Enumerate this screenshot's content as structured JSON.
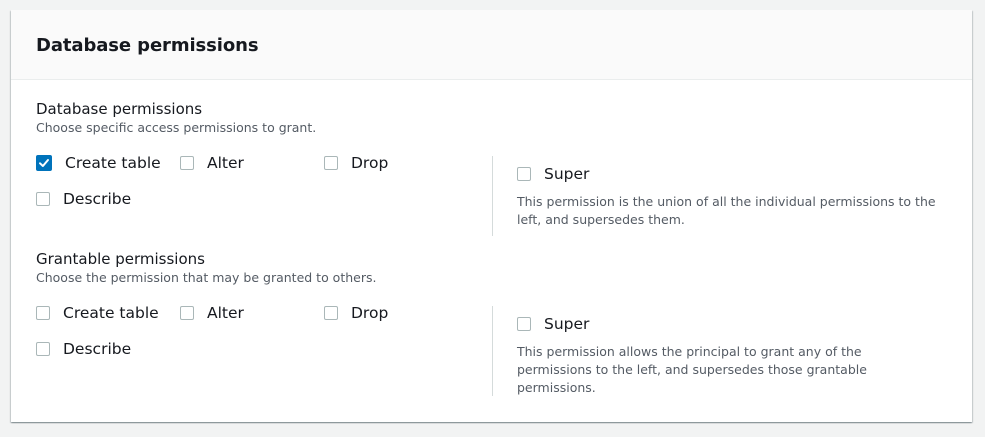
{
  "panel": {
    "title": "Database permissions"
  },
  "database_permissions": {
    "label": "Database permissions",
    "description": "Choose specific access permissions to grant.",
    "options": [
      {
        "label": "Create table",
        "checked": true
      },
      {
        "label": "Alter",
        "checked": false
      },
      {
        "label": "Drop",
        "checked": false
      },
      {
        "label": "Describe",
        "checked": false
      }
    ],
    "super": {
      "label": "Super",
      "checked": false,
      "description": "This permission is the union of all the individual permissions to the left, and supersedes them."
    }
  },
  "grantable_permissions": {
    "label": "Grantable permissions",
    "description": "Choose the permission that may be granted to others.",
    "options": [
      {
        "label": "Create table",
        "checked": false
      },
      {
        "label": "Alter",
        "checked": false
      },
      {
        "label": "Drop",
        "checked": false
      },
      {
        "label": "Describe",
        "checked": false
      }
    ],
    "super": {
      "label": "Super",
      "checked": false,
      "description": "This permission allows the principal to grant any of the permissions to the left, and supersedes those grantable permissions."
    }
  },
  "colors": {
    "accent": "#0073bb",
    "checkbox_border": "#aab7b8",
    "header_bg": "#fafafa",
    "muted_text": "#545b64"
  }
}
